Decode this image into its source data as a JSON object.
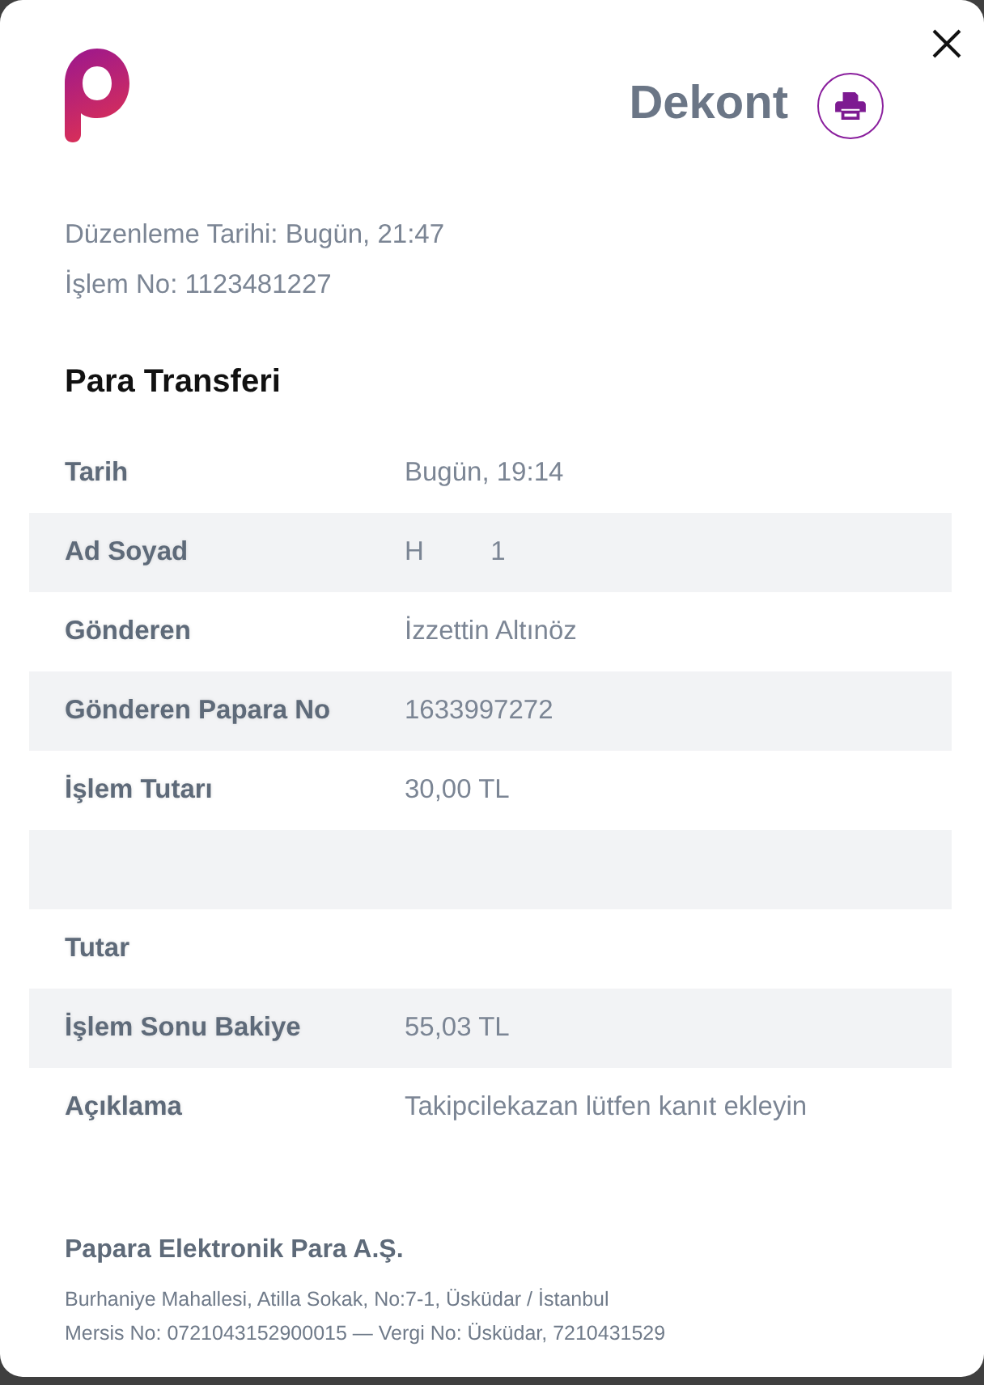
{
  "header": {
    "title": "Dekont"
  },
  "meta": [
    "Düzenleme Tarihi: Bugün, 21:47",
    "İşlem No: 1123481227"
  ],
  "section_title": "Para Transferi",
  "rows": [
    {
      "kind": "pair",
      "label": "Tarih",
      "value": "Bugün, 19:14"
    },
    {
      "kind": "pair",
      "label": "Ad Soyad",
      "value": "H         1"
    },
    {
      "kind": "pair",
      "label": "Gönderen",
      "value": "İzzettin Altınöz"
    },
    {
      "kind": "pair",
      "label": "Gönderen Papara No",
      "value": "1633997272"
    },
    {
      "kind": "pair",
      "label": "İşlem Tutarı",
      "value": "30,00 TL"
    },
    {
      "kind": "blank"
    },
    {
      "kind": "pair",
      "label": "Tutar"
    },
    {
      "kind": "pair",
      "label": "İşlem Sonu Bakiye",
      "value": "55,03 TL"
    },
    {
      "kind": "pair",
      "label": "Açıklama",
      "value": "Takipcilekazan lütfen kanıt ekleyin"
    }
  ],
  "footer": {
    "company": "Papara Elektronik Para A.Ş.",
    "address_lines": [
      "Burhaniye Mahallesi, Atilla Sokak, No:7-1, Üsküdar / İstanbul",
      "Mersis No: 0721043152900015 — Vergi No: Üsküdar, 7210431529"
    ]
  }
}
